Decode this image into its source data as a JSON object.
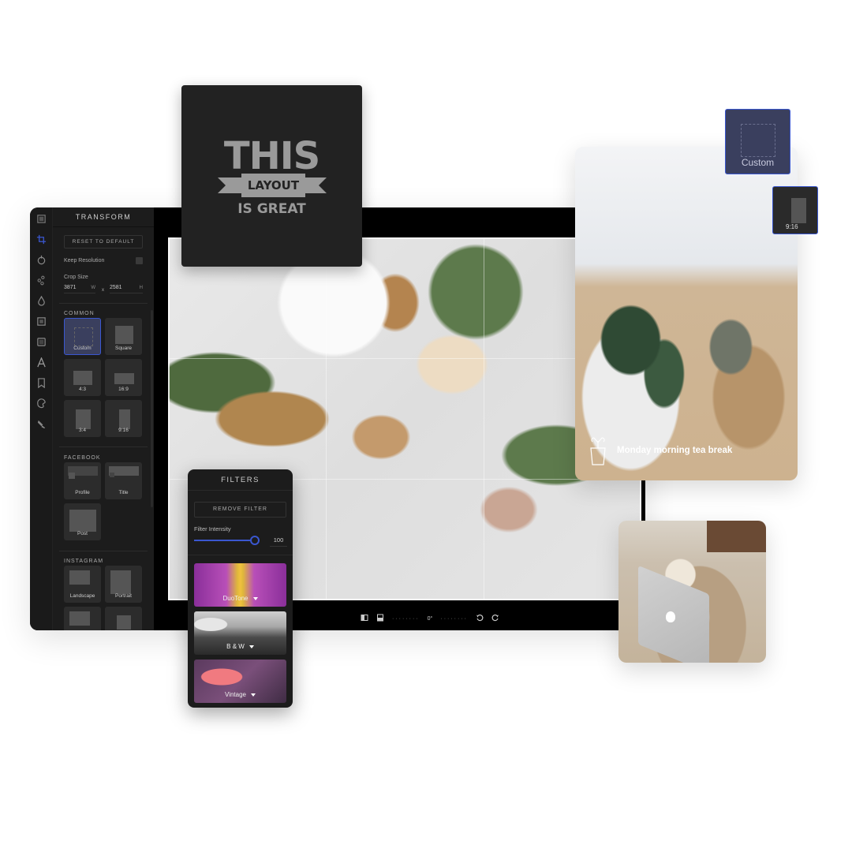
{
  "editor": {
    "panel_title": "TRANSFORM",
    "reset_label": "RESET TO DEFAULT",
    "keep_resolution_label": "Keep Resolution",
    "keep_resolution_checked": false,
    "crop_size_label": "Crop Size",
    "crop_width": "3871",
    "crop_width_unit": "W",
    "crop_separator": "x",
    "crop_height": "2581",
    "crop_height_unit": "H",
    "sidebar_icons": [
      "library-icon",
      "crop-icon",
      "adjust-icon",
      "effects-icon",
      "drop-icon",
      "frame-icon",
      "layer-icon",
      "text-icon",
      "sticker-icon",
      "paint-icon",
      "brush-icon"
    ],
    "active_icon": "crop-icon",
    "accent_color": "#3a57d0",
    "sections": {
      "common": {
        "label": "COMMON",
        "items": [
          {
            "label": "Custom",
            "active": true
          },
          {
            "label": "Square",
            "active": false
          },
          {
            "label": "4:3",
            "active": false
          },
          {
            "label": "16:9",
            "active": false
          },
          {
            "label": "3:4",
            "active": false
          },
          {
            "label": "9:16",
            "active": false
          }
        ]
      },
      "facebook": {
        "label": "FACEBOOK",
        "items": [
          {
            "label": "Profile"
          },
          {
            "label": "Title"
          },
          {
            "label": "Post"
          }
        ]
      },
      "instagram": {
        "label": "INSTAGRAM",
        "items": [
          {
            "label": "Landscape"
          },
          {
            "label": "Portrait"
          },
          {
            "label": ""
          },
          {
            "label": ""
          }
        ]
      }
    },
    "toolbar": {
      "flip_horizontal_icon": "flip-horizontal-icon",
      "flip_vertical_icon": "flip-vertical-icon",
      "rotation_value": "0°",
      "rotate_left_icon": "rotate-left-icon",
      "rotate_right_icon": "rotate-right-icon"
    }
  },
  "layout_card": {
    "line1": "THIS",
    "line2": "LAYOUT",
    "line3": "IS GREAT"
  },
  "floating_presets": {
    "custom_label": "Custom",
    "ratio_label": "9:16"
  },
  "tea_card": {
    "caption": "Monday morning tea break"
  },
  "filters": {
    "title": "FILTERS",
    "remove_label": "REMOVE FILTER",
    "intensity_label": "Filter Intensity",
    "intensity_value": "100",
    "intensity_fraction": 1.0,
    "items": [
      {
        "label": "DuoTone"
      },
      {
        "label": "B & W"
      },
      {
        "label": "Vintage"
      }
    ]
  }
}
